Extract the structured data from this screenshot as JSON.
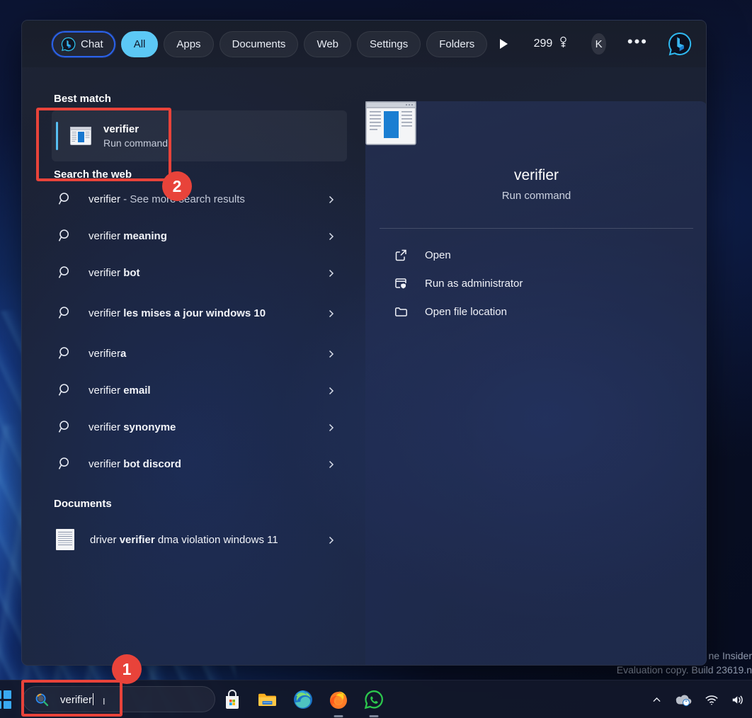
{
  "desktop": {
    "watermark_line1": "ne Insider",
    "watermark_line2": "Evaluation copy. Build 23619.n"
  },
  "header": {
    "tabs": [
      {
        "label": "Chat",
        "state": "focused",
        "icon": "bing-chat-icon"
      },
      {
        "label": "All",
        "state": "active"
      },
      {
        "label": "Apps",
        "state": "normal"
      },
      {
        "label": "Documents",
        "state": "normal"
      },
      {
        "label": "Web",
        "state": "normal"
      },
      {
        "label": "Settings",
        "state": "normal"
      },
      {
        "label": "Folders",
        "state": "normal"
      }
    ],
    "next_tabs_icon": "play-arrow-icon",
    "rewards_points": "299",
    "rewards_icon": "rewards-medal-icon",
    "avatar_initial": "K",
    "overflow_label": "•••",
    "bing_logo_icon": "bing-logo-icon",
    "accent_active": "#5cc8f5",
    "accent_focus_ring": "#2b62ea"
  },
  "results": {
    "best_match_header": "Best match",
    "best_match": {
      "title": "verifier",
      "subtitle": "Run command",
      "icon": "verifier-app-icon",
      "accent_color": "#57bff2"
    },
    "search_web_header": "Search the web",
    "web_suggestions": [
      {
        "prefix": "verifier",
        "suffix": " - See more search results",
        "suffix_style": "dim",
        "icon": "search-icon"
      },
      {
        "prefix": "verifier ",
        "suffix": "meaning",
        "suffix_style": "bold",
        "icon": "search-icon"
      },
      {
        "prefix": "verifier ",
        "suffix": "bot",
        "suffix_style": "bold",
        "icon": "search-icon"
      },
      {
        "prefix": "verifier ",
        "suffix": "les mises a jour windows 10",
        "suffix_style": "bold",
        "icon": "search-icon"
      },
      {
        "prefix": "verifier",
        "suffix": "a",
        "suffix_style": "bold",
        "icon": "search-icon"
      },
      {
        "prefix": "verifier ",
        "suffix": "email",
        "suffix_style": "bold",
        "icon": "search-icon"
      },
      {
        "prefix": "verifier ",
        "suffix": "synonyme",
        "suffix_style": "bold",
        "icon": "search-icon"
      },
      {
        "prefix": "verifier ",
        "suffix": "bot discord",
        "suffix_style": "bold",
        "icon": "search-icon"
      }
    ],
    "documents_header": "Documents",
    "documents": [
      {
        "pre": "driver ",
        "match": "verifier",
        "post": " dma violation windows 11",
        "icon": "document-thumbnail-icon"
      }
    ]
  },
  "preview": {
    "app_icon": "verifier-app-icon-large",
    "title": "verifier",
    "subtitle": "Run command",
    "actions": [
      {
        "label": "Open",
        "icon": "open-external-icon"
      },
      {
        "label": "Run as administrator",
        "icon": "shield-window-icon"
      },
      {
        "label": "Open file location",
        "icon": "folder-icon"
      }
    ]
  },
  "taskbar": {
    "start_icon": "windows-start-icon",
    "search": {
      "value": "verifier",
      "icon": "search-icon-color"
    },
    "apps": [
      {
        "name": "microsoft-store",
        "running": false
      },
      {
        "name": "file-explorer",
        "running": false
      },
      {
        "name": "microsoft-edge",
        "running": false
      },
      {
        "name": "firefox",
        "running": true
      },
      {
        "name": "whatsapp",
        "running": true
      }
    ],
    "tray": [
      {
        "name": "hidden-icons-chevron"
      },
      {
        "name": "onedrive-cloud"
      },
      {
        "name": "wifi"
      },
      {
        "name": "volume"
      }
    ]
  },
  "annotations": {
    "color": "#e8433a",
    "badges": [
      {
        "number": "1",
        "target": "taskbar-search-box"
      },
      {
        "number": "2",
        "target": "best-match-verifier-row"
      }
    ]
  }
}
